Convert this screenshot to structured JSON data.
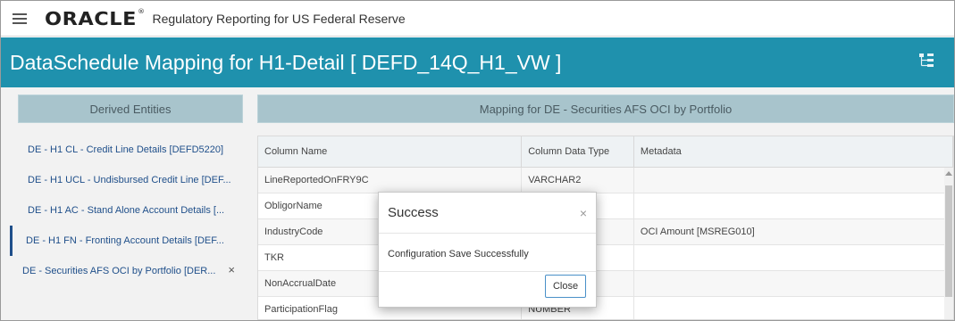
{
  "header": {
    "logo": "ORACLE",
    "logo_mark": "®",
    "app_title": "Regulatory Reporting for US Federal Reserve"
  },
  "title_bar": {
    "page_title": "DataSchedule Mapping for H1-Detail [ DEFD_14Q_H1_VW ]"
  },
  "left_panel": {
    "header": "Derived Entities",
    "items": [
      {
        "label": "DE - H1 CL - Credit Line Details [DEFD5220]"
      },
      {
        "label": "DE - H1 UCL - Undisbursed Credit Line [DEF..."
      },
      {
        "label": "DE - H1 AC - Stand Alone Account Details [..."
      },
      {
        "label": "DE - H1 FN - Fronting Account Details [DEF..."
      },
      {
        "label": "DE - Securities AFS OCI by Portfolio [DER...",
        "close": "×"
      }
    ]
  },
  "right_panel": {
    "header": "Mapping for DE - Securities AFS OCI by Portfolio",
    "columns": [
      "Column Name",
      "Column Data Type",
      "Metadata"
    ],
    "rows": [
      [
        "LineReportedOnFRY9C",
        "VARCHAR2",
        ""
      ],
      [
        "ObligorName",
        "",
        ""
      ],
      [
        "IndustryCode",
        "",
        "OCI Amount [MSREG010]"
      ],
      [
        "TKR",
        "",
        ""
      ],
      [
        "NonAccrualDate",
        "",
        ""
      ],
      [
        "ParticipationFlag",
        "NUMBER",
        ""
      ]
    ]
  },
  "modal": {
    "title": "Success",
    "close_x": "×",
    "message": "Configuration Save Successfully",
    "close_label": "Close"
  }
}
